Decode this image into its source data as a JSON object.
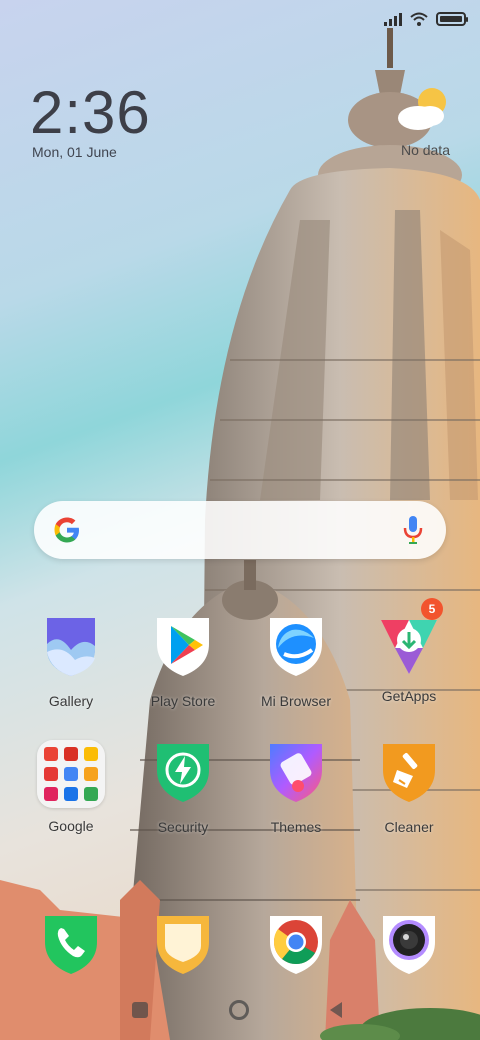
{
  "status_bar": {
    "signal_icon": "signal-icon",
    "wifi_icon": "wifi-icon",
    "battery_icon": "battery-icon",
    "battery_level": 1.0
  },
  "clock": {
    "time": "2:36",
    "date": "Mon, 01 June"
  },
  "weather": {
    "icon": "partly-cloudy-icon",
    "label": "No data"
  },
  "search": {
    "logo": "google-g-icon",
    "mic": "microphone-icon"
  },
  "apps": {
    "gallery": {
      "label": "Gallery"
    },
    "play_store": {
      "label": "Play Store"
    },
    "mi_browser": {
      "label": "Mi Browser"
    },
    "getapps": {
      "label": "GetApps",
      "badge": "5"
    },
    "google_folder": {
      "label": "Google"
    },
    "security": {
      "label": "Security"
    },
    "themes": {
      "label": "Themes"
    },
    "cleaner": {
      "label": "Cleaner"
    }
  },
  "dock": {
    "phone": "phone-icon",
    "notes": "notes-icon",
    "chrome": "chrome-icon",
    "camera": "camera-icon"
  },
  "colors": {
    "badge": "#f2542d",
    "security_green": "#1fbf73",
    "cleaner_orange": "#f29a1f",
    "phone_green": "#22c55e"
  }
}
